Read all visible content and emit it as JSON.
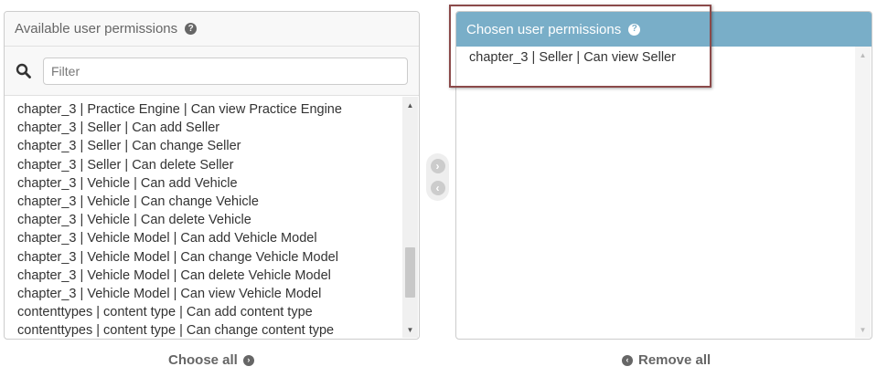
{
  "available": {
    "title": "Available user permissions",
    "help_icon": "?",
    "filter_placeholder": "Filter",
    "filter_value": "",
    "items": [
      "chapter_3 | Practice Engine | Can view Practice Engine",
      "chapter_3 | Seller | Can add Seller",
      "chapter_3 | Seller | Can change Seller",
      "chapter_3 | Seller | Can delete Seller",
      "chapter_3 | Vehicle | Can add Vehicle",
      "chapter_3 | Vehicle | Can change Vehicle",
      "chapter_3 | Vehicle | Can delete Vehicle",
      "chapter_3 | Vehicle Model | Can add Vehicle Model",
      "chapter_3 | Vehicle Model | Can change Vehicle Model",
      "chapter_3 | Vehicle Model | Can delete Vehicle Model",
      "chapter_3 | Vehicle Model | Can view Vehicle Model",
      "contenttypes | content type | Can add content type",
      "contenttypes | content type | Can change content type"
    ],
    "choose_all_label": "Choose all"
  },
  "chosen": {
    "title": "Chosen user permissions",
    "help_icon": "?",
    "items": [
      "chapter_3 | Seller | Can view Seller"
    ],
    "remove_all_label": "Remove all"
  },
  "icons": {
    "search": "search-icon",
    "add": "arrow-right-circle-icon",
    "remove": "arrow-left-circle-icon",
    "choose_all": "chevron-right-circle-icon",
    "remove_all": "chevron-left-circle-icon"
  },
  "colors": {
    "chosen_header": "#79aec8",
    "available_header": "#f8f8f8",
    "link_text": "#666666",
    "highlight_border": "#8b4a4a"
  }
}
